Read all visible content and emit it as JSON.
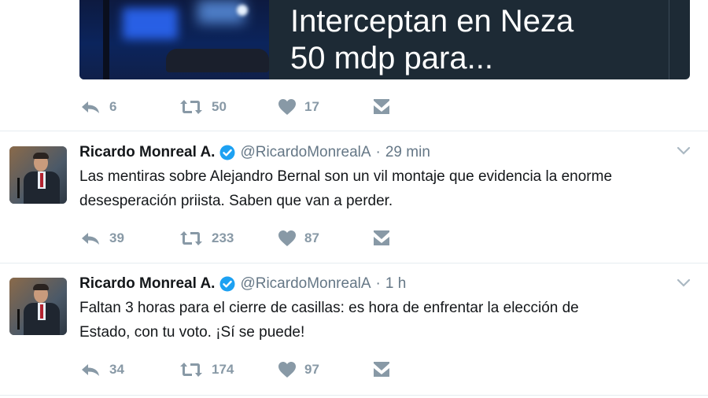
{
  "prev_tweet": {
    "card": {
      "title_line1": "Interceptan en Neza",
      "title_line2": "50 mdp para..."
    },
    "actions": {
      "replies": "6",
      "retweets": "50",
      "likes": "17"
    }
  },
  "tweets": [
    {
      "name": "Ricardo Monreal A.",
      "handle": "@RicardoMonrealA",
      "separator": "·",
      "time": "29 min",
      "text_line1": "Las mentiras sobre Alejandro Bernal son un vil montaje que evidencia la enorme",
      "text_line2": "desesperación priista. Saben que van a perder.",
      "actions": {
        "replies": "39",
        "retweets": "233",
        "likes": "87"
      }
    },
    {
      "name": "Ricardo Monreal A.",
      "handle": "@RicardoMonrealA",
      "separator": "·",
      "time": "1 h",
      "text_line1": "Faltan 3 horas para el cierre de casillas: es hora de enfrentar la elección de",
      "text_line2": "Estado, con tu voto. ¡Sí se puede!",
      "actions": {
        "replies": "34",
        "retweets": "174",
        "likes": "97"
      }
    }
  ],
  "icons": {
    "reply": "reply-icon",
    "retweet": "retweet-icon",
    "like": "heart-icon",
    "dm": "envelope-icon",
    "verified": "verified-badge-icon",
    "more": "chevron-down-icon"
  },
  "colors": {
    "icon_gray": "#8899a6",
    "verified_blue": "#1da1f2",
    "card_bg": "#1d2a35",
    "separator": "#e6ecf0"
  }
}
